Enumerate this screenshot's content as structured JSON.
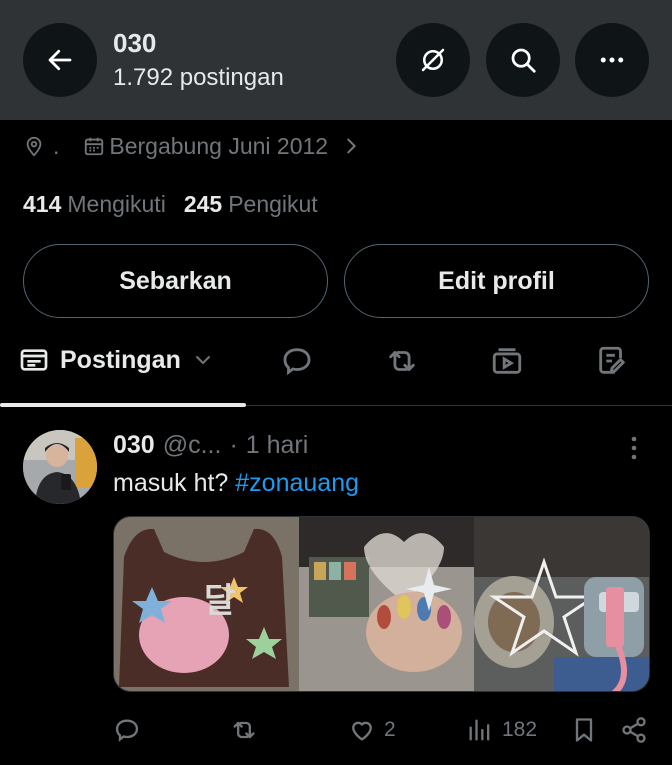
{
  "header": {
    "title": "030",
    "subtitle": "1.792 postingan"
  },
  "profile": {
    "location": ".",
    "joined": "Bergabung Juni 2012",
    "following_count": "414",
    "following_label": "Mengikuti",
    "followers_count": "245",
    "followers_label": "Pengikut",
    "share_label": "Sebarkan",
    "edit_label": "Edit profil"
  },
  "tabs": {
    "active_label": "Postingan"
  },
  "post": {
    "name": "030",
    "handle": "@c...",
    "separator": "·",
    "time": "1 hari",
    "text": "masuk ht? ",
    "hashtag": "#zonauang",
    "likes": "2",
    "views": "182"
  },
  "icons": {
    "back": "arrow-left-icon",
    "grok": "grok-icon",
    "search": "search-icon",
    "more": "more-horizontal-icon",
    "location": "location-pin-icon",
    "calendar": "calendar-icon",
    "chevron": "chevron-right-icon"
  },
  "colors": {
    "accent": "#1d9bf0",
    "muted": "#71767b",
    "text": "#e7e9ea",
    "header_bg": "#2f3336"
  }
}
